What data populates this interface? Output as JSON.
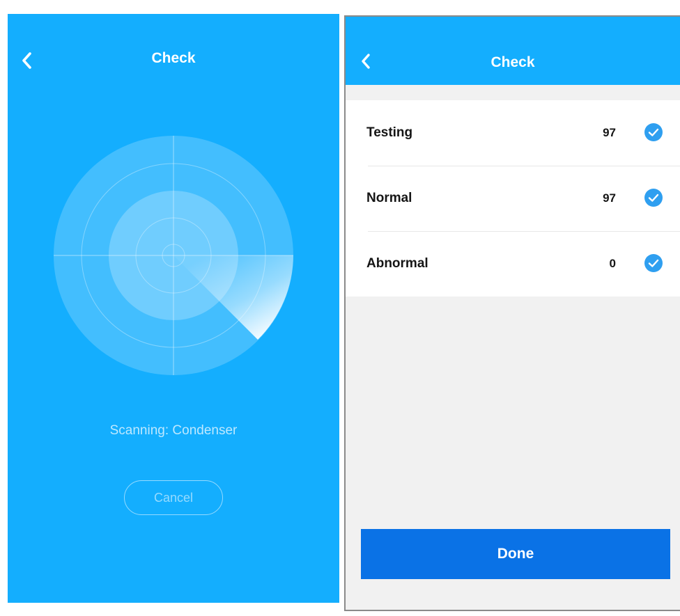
{
  "scanning_screen": {
    "title": "Check",
    "back_icon": "chevron-left-icon",
    "radar_icon": "radar-scan-icon",
    "status_label": "Scanning",
    "status_separator": ":",
    "status_target": "Condenser",
    "cancel_label": "Cancel"
  },
  "results_screen": {
    "title": "Check",
    "back_icon": "chevron-left-icon",
    "rows": [
      {
        "label": "Testing",
        "value": "97",
        "icon": "check-circle-icon"
      },
      {
        "label": "Normal",
        "value": "97",
        "icon": "check-circle-icon"
      },
      {
        "label": "Abnormal",
        "value": "0",
        "icon": "check-circle-icon"
      }
    ],
    "done_label": "Done"
  },
  "colors": {
    "primary_blue": "#14aefe",
    "done_button_blue": "#0a72e6",
    "check_blue": "#2f9ff0",
    "list_background": "#f1f1f1"
  }
}
